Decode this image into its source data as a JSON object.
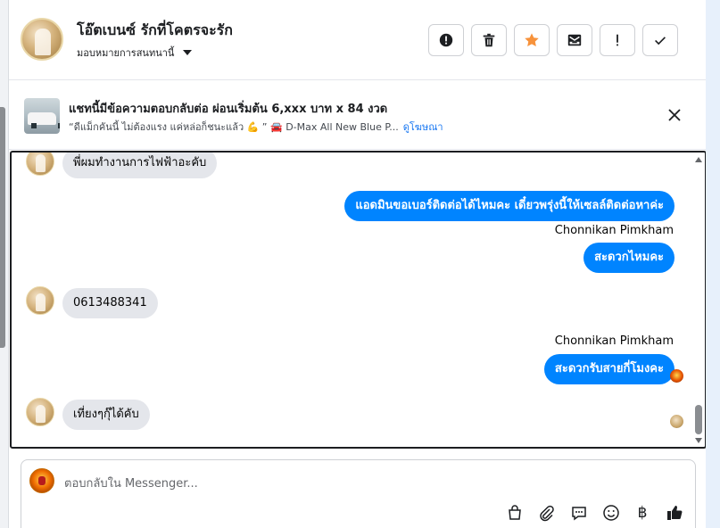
{
  "header": {
    "contact_name": "โอ๊ตเบนซ์ รักที่โคตรจะรัก",
    "assign_label": "มอบหมายการสนทนานี้",
    "toolbar": [
      {
        "name": "report-spam-button",
        "icon": "exclamation-circle-icon"
      },
      {
        "name": "delete-button",
        "icon": "trash-icon"
      },
      {
        "name": "star-button",
        "icon": "star-icon",
        "color": "#f7923b"
      },
      {
        "name": "mark-unread-button",
        "icon": "envelope-icon"
      },
      {
        "name": "mark-follow-up-button",
        "icon": "exclamation-icon"
      },
      {
        "name": "mark-done-button",
        "icon": "check-icon"
      }
    ]
  },
  "ad_banner": {
    "title": "แชทนี้มีข้อความตอบกลับต่อ ผ่อนเริ่มต้น 6,xxx บาท x 84 งวด",
    "subtitle_text": "“ดีแม็กคันนี้ ไม่ต้องแรง แค่หล่อก็ชนะแล้ว 💪 ” 🚘 D-Max All New Blue P...",
    "view_ad_link": "ดูโฆษณา"
  },
  "messages": {
    "m1": "พี่ผมทำงานการไฟฟ้าอะคับ",
    "m2": "แอดมินขอเบอร์ติดต่อได้ไหมคะ เดี๋ยวพรุ่งนี้ให้เซลล์ติดต่อหาค่ะ",
    "sender1": "Chonnikan Pimkham",
    "m3": "สะดวกไหมคะ",
    "m4": "0613488341",
    "sender2": "Chonnikan Pimkham",
    "m5": "สะดวกรับสายกี่โมงคะ",
    "m6": "เที่ยงๆกุ๊ได้คับ"
  },
  "composer": {
    "placeholder": "ตอบกลับใน Messenger...",
    "currency_symbol": "฿"
  },
  "colors": {
    "outgoing_bubble": "#0084ff",
    "incoming_bubble": "#e4e6eb",
    "link": "#1877f2"
  }
}
